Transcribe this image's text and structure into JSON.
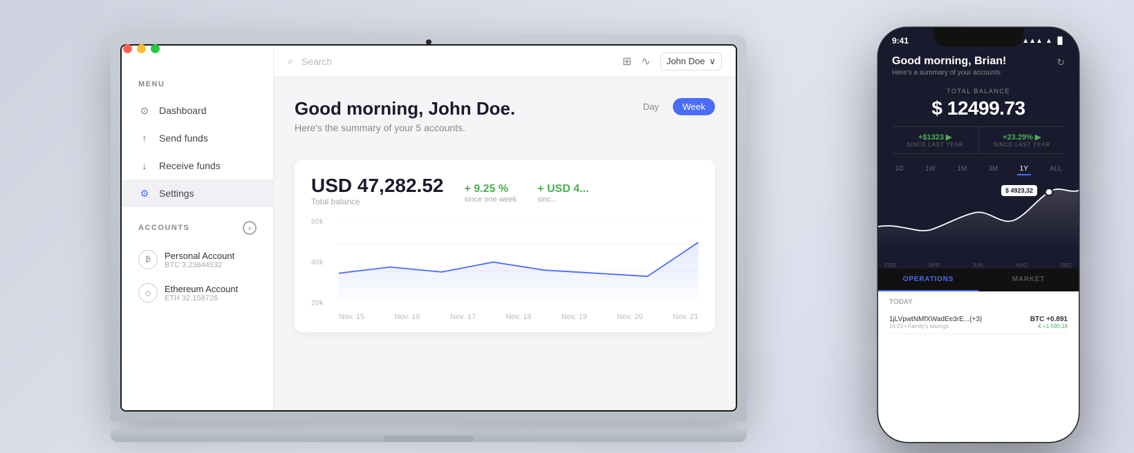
{
  "background": "#dde0ea",
  "laptop": {
    "sidebar": {
      "menu_label": "MENU",
      "nav_items": [
        {
          "id": "dashboard",
          "label": "Dashboard",
          "icon": "clock",
          "active": false
        },
        {
          "id": "send-funds",
          "label": "Send funds",
          "icon": "arrow-up",
          "active": false
        },
        {
          "id": "receive-funds",
          "label": "Receive funds",
          "icon": "arrow-down",
          "active": false
        },
        {
          "id": "settings",
          "label": "Settings",
          "icon": "gear",
          "active": true
        }
      ],
      "accounts_label": "ACCOUNTS",
      "add_button_label": "+",
      "accounts": [
        {
          "id": "personal",
          "name": "Personal Account",
          "sub": "BTC 3.23644532",
          "icon": "₿"
        },
        {
          "id": "ethereum",
          "name": "Ethereum Account",
          "sub": "ETH 32.158726",
          "icon": "◇"
        }
      ]
    },
    "topbar": {
      "search_placeholder": "Search",
      "user_name": "John Doe",
      "user_chevron": "∨"
    },
    "dashboard": {
      "greeting": "Good morning, John Doe.",
      "sub_greeting": "Here's the summary of your 5 accounts.",
      "period_tabs": [
        "Day",
        "Week"
      ],
      "active_period": "Week",
      "balance_main": "USD 47,282.52",
      "balance_sub": "Total balance",
      "stat1_value": "+ 9.25 %",
      "stat1_label": "since one week",
      "stat2_value": "+ USD 4...",
      "stat2_label": "sinc...",
      "chart_yaxis": [
        "60k",
        "40k",
        "20k"
      ],
      "chart_xaxis": [
        "Nov. 15",
        "Nov. 16",
        "Nov. 17",
        "Nov. 18",
        "Nov. 19",
        "Nov. 20",
        "Nov. 21"
      ]
    }
  },
  "phone": {
    "status_time": "9:41",
    "status_icons": "▲ ▲ ◼",
    "greeting": "Good morning, Brian!",
    "sub_greeting": "Here's a summary of your accounts",
    "balance_label": "TOTAL BALANCE",
    "balance_amount": "$ 12499.73",
    "stat1_value": "+$1323 ▶",
    "stat1_label": "SINCE LAST YEAR",
    "stat2_value": "+23.29% ▶",
    "stat2_label": "SINCE LAST YEAR",
    "period_tabs": [
      "1D",
      "1W",
      "1M",
      "3M",
      "1Y",
      "ALL"
    ],
    "active_period": "1Y",
    "chart_tooltip": "$ 4923,32",
    "chart_xaxis": [
      "FEB",
      "APR",
      "JUN",
      "AUG",
      "DEC"
    ],
    "tabs": [
      "OPERATIONS",
      "MARKET"
    ],
    "active_tab": "OPERATIONS",
    "today_label": "TODAY",
    "operations": [
      {
        "hash": "1jLVpwtNMfXWadEe3rE...(+3)",
        "meta": "14:23 • Family's savings",
        "currency": "BTC +0.891",
        "amount": "€ +1,590.18"
      }
    ]
  }
}
